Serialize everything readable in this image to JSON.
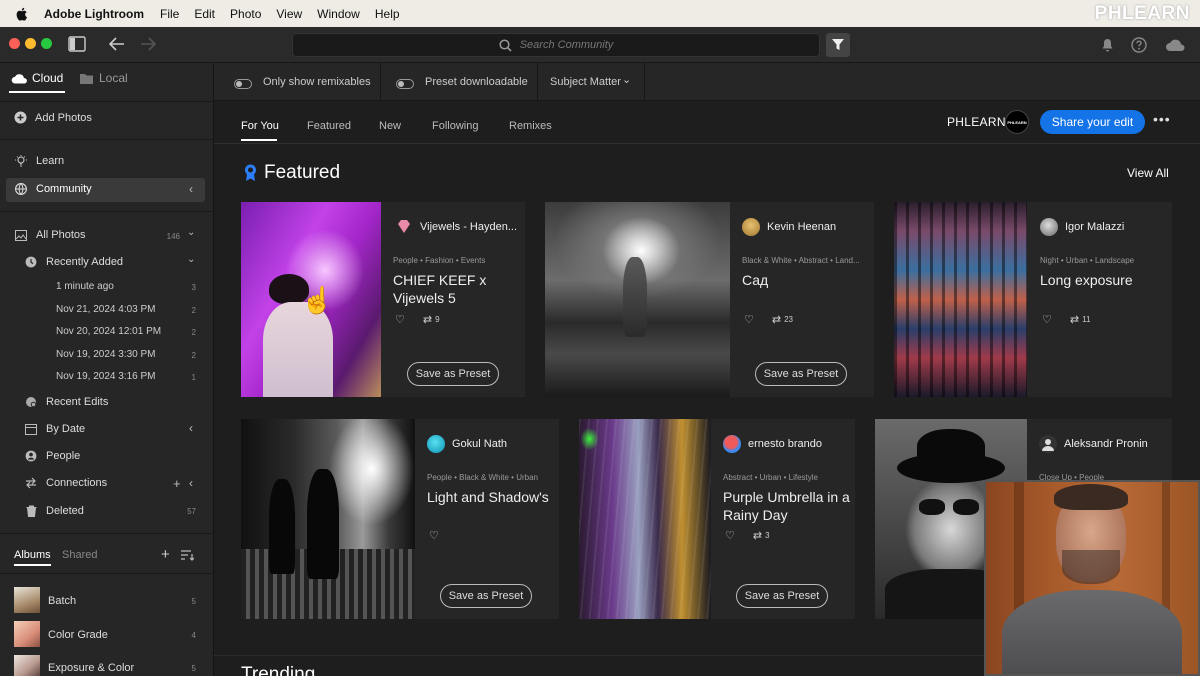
{
  "menubar": {
    "app": "Adobe Lightroom",
    "items": [
      "File",
      "Edit",
      "Photo",
      "View",
      "Window",
      "Help"
    ]
  },
  "watermark": "PHLEARN",
  "search": {
    "placeholder": "Search Community"
  },
  "sidebar": {
    "cloud": "Cloud",
    "local": "Local",
    "add_photos": "Add Photos",
    "learn": "Learn",
    "community": "Community",
    "all_photos": {
      "label": "All Photos",
      "count": "146"
    },
    "recently_added": "Recently Added",
    "dates": [
      {
        "label": "1 minute ago",
        "count": "3"
      },
      {
        "label": "Nov 21, 2024 4:03 PM",
        "count": "2"
      },
      {
        "label": "Nov 20, 2024 12:01 PM",
        "count": "2"
      },
      {
        "label": "Nov 19, 2024 3:30 PM",
        "count": "2"
      },
      {
        "label": "Nov 19, 2024 3:16 PM",
        "count": "1"
      }
    ],
    "recent_edits": "Recent Edits",
    "by_date": "By Date",
    "people": "People",
    "connections": "Connections",
    "deleted": {
      "label": "Deleted",
      "count": "57"
    },
    "albums_tab": "Albums",
    "shared_tab": "Shared",
    "albums": [
      {
        "label": "Batch",
        "count": "5"
      },
      {
        "label": "Color Grade",
        "count": "4"
      },
      {
        "label": "Exposure & Color",
        "count": "5"
      }
    ]
  },
  "filters": {
    "remixables": "Only show remixables",
    "downloadable": "Preset downloadable",
    "subject": "Subject Matter"
  },
  "tabs": [
    "For You",
    "Featured",
    "New",
    "Following",
    "Remixes"
  ],
  "profile": {
    "name": "PHLEARN",
    "avatar_text": "PHLEARN"
  },
  "share_label": "Share your edit",
  "featured": {
    "title": "Featured",
    "view_all": "View All"
  },
  "preset_label": "Save as Preset",
  "cards": [
    {
      "author": "Vijewels - Hayden...",
      "tags": "People • Fashion • Events",
      "title": "CHIEF KEEF x Vijewels 5",
      "remixes": "9"
    },
    {
      "author": "Kevin Heenan",
      "tags": "Black & White • Abstract • Land...",
      "title": "Сад",
      "remixes": "23"
    },
    {
      "author": "Igor Malazzi",
      "tags": "Night • Urban • Landscape",
      "title": "Long exposure",
      "remixes": "11"
    },
    {
      "author": "Gokul Nath",
      "tags": "People • Black & White • Urban",
      "title": "Light and Shadow's",
      "remixes": ""
    },
    {
      "author": "ernesto brando",
      "tags": "Abstract • Urban • Lifestyle",
      "title": "Purple Umbrella in a Rainy Day",
      "remixes": "3"
    },
    {
      "author": "Aleksandr Pronin",
      "tags": "Close Up • People",
      "title": "",
      "remixes": ""
    }
  ],
  "trending": "Trending",
  "colors": {
    "accent": "#1473e6"
  }
}
